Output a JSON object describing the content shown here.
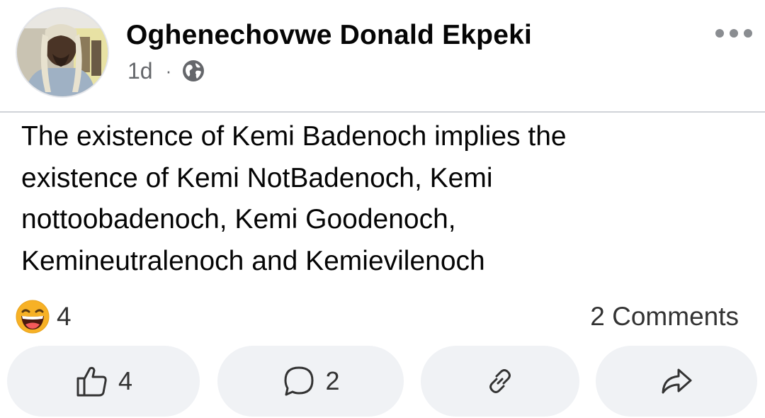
{
  "post": {
    "author": "Oghenechovwe Donald Ekpeki",
    "time": "1d",
    "separator": "·",
    "audience_icon": "globe-icon",
    "more_icon": "more-horizontal-icon",
    "text": "The existence of Kemi Badenoch implies the\nexistence of Kemi NotBadenoch, Kemi\nnottoobadenoch, Kemi Goodenoch,\nKemineutralenoch and Kemievilenoch"
  },
  "engagement": {
    "reaction_icon": "haha-emoji-icon",
    "reaction_count": "4",
    "comments_label": "2 Comments"
  },
  "actions": {
    "like": {
      "icon": "thumbs-up-icon",
      "count": "4"
    },
    "comment": {
      "icon": "comment-bubble-icon",
      "count": "2"
    },
    "copy_link": {
      "icon": "link-icon"
    },
    "share": {
      "icon": "share-arrow-icon"
    }
  },
  "colors": {
    "text_primary": "#050505",
    "text_secondary": "#65676b",
    "button_bg": "#f0f2f5",
    "divider": "#d0d3d8",
    "emoji_yellow": "#f7b125"
  }
}
